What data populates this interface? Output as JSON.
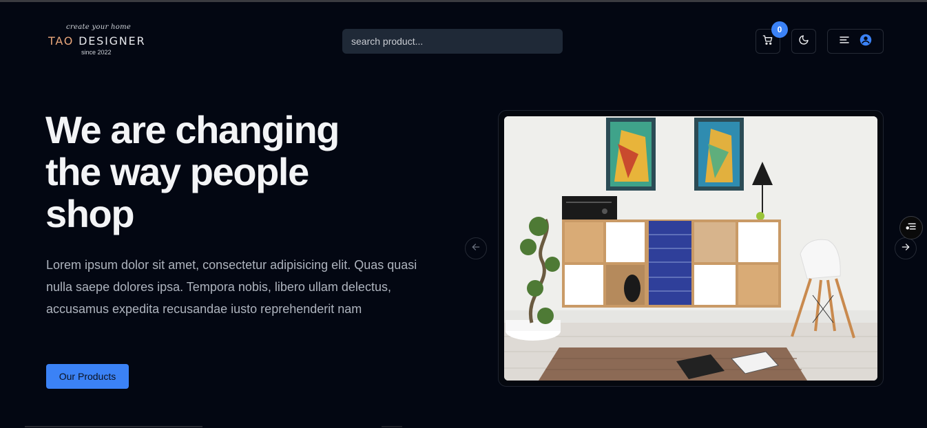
{
  "header": {
    "logo": {
      "tagline": "create your home",
      "brand_accent": "TAO",
      "brand_rest": " DESIGNER",
      "since": "since 2022"
    },
    "search": {
      "placeholder": "search product...",
      "value": ""
    },
    "cart": {
      "icon": "cart-icon",
      "count": "0"
    },
    "theme_toggle": {
      "icon": "moon-icon"
    },
    "menu": {
      "icons": [
        "menu-icon",
        "user-icon"
      ]
    }
  },
  "hero": {
    "title": "We are changing the way people shop",
    "description": "Lorem ipsum dolor sit amet, consectetur adipisicing elit. Quas quasi nulla saepe dolores ipsa. Tempora nobis, libero ullam delectus, accusamus expedita recusandae iusto reprehenderit nam",
    "cta_label": "Our Products"
  },
  "carousel": {
    "prev_icon": "arrow-left-icon",
    "next_icon": "arrow-right-icon"
  },
  "colors": {
    "background": "#030712",
    "accent": "#3b82f6",
    "input_bg": "#1f2937",
    "muted_text": "#aeb4be",
    "logo_accent": "#e9a77b"
  }
}
